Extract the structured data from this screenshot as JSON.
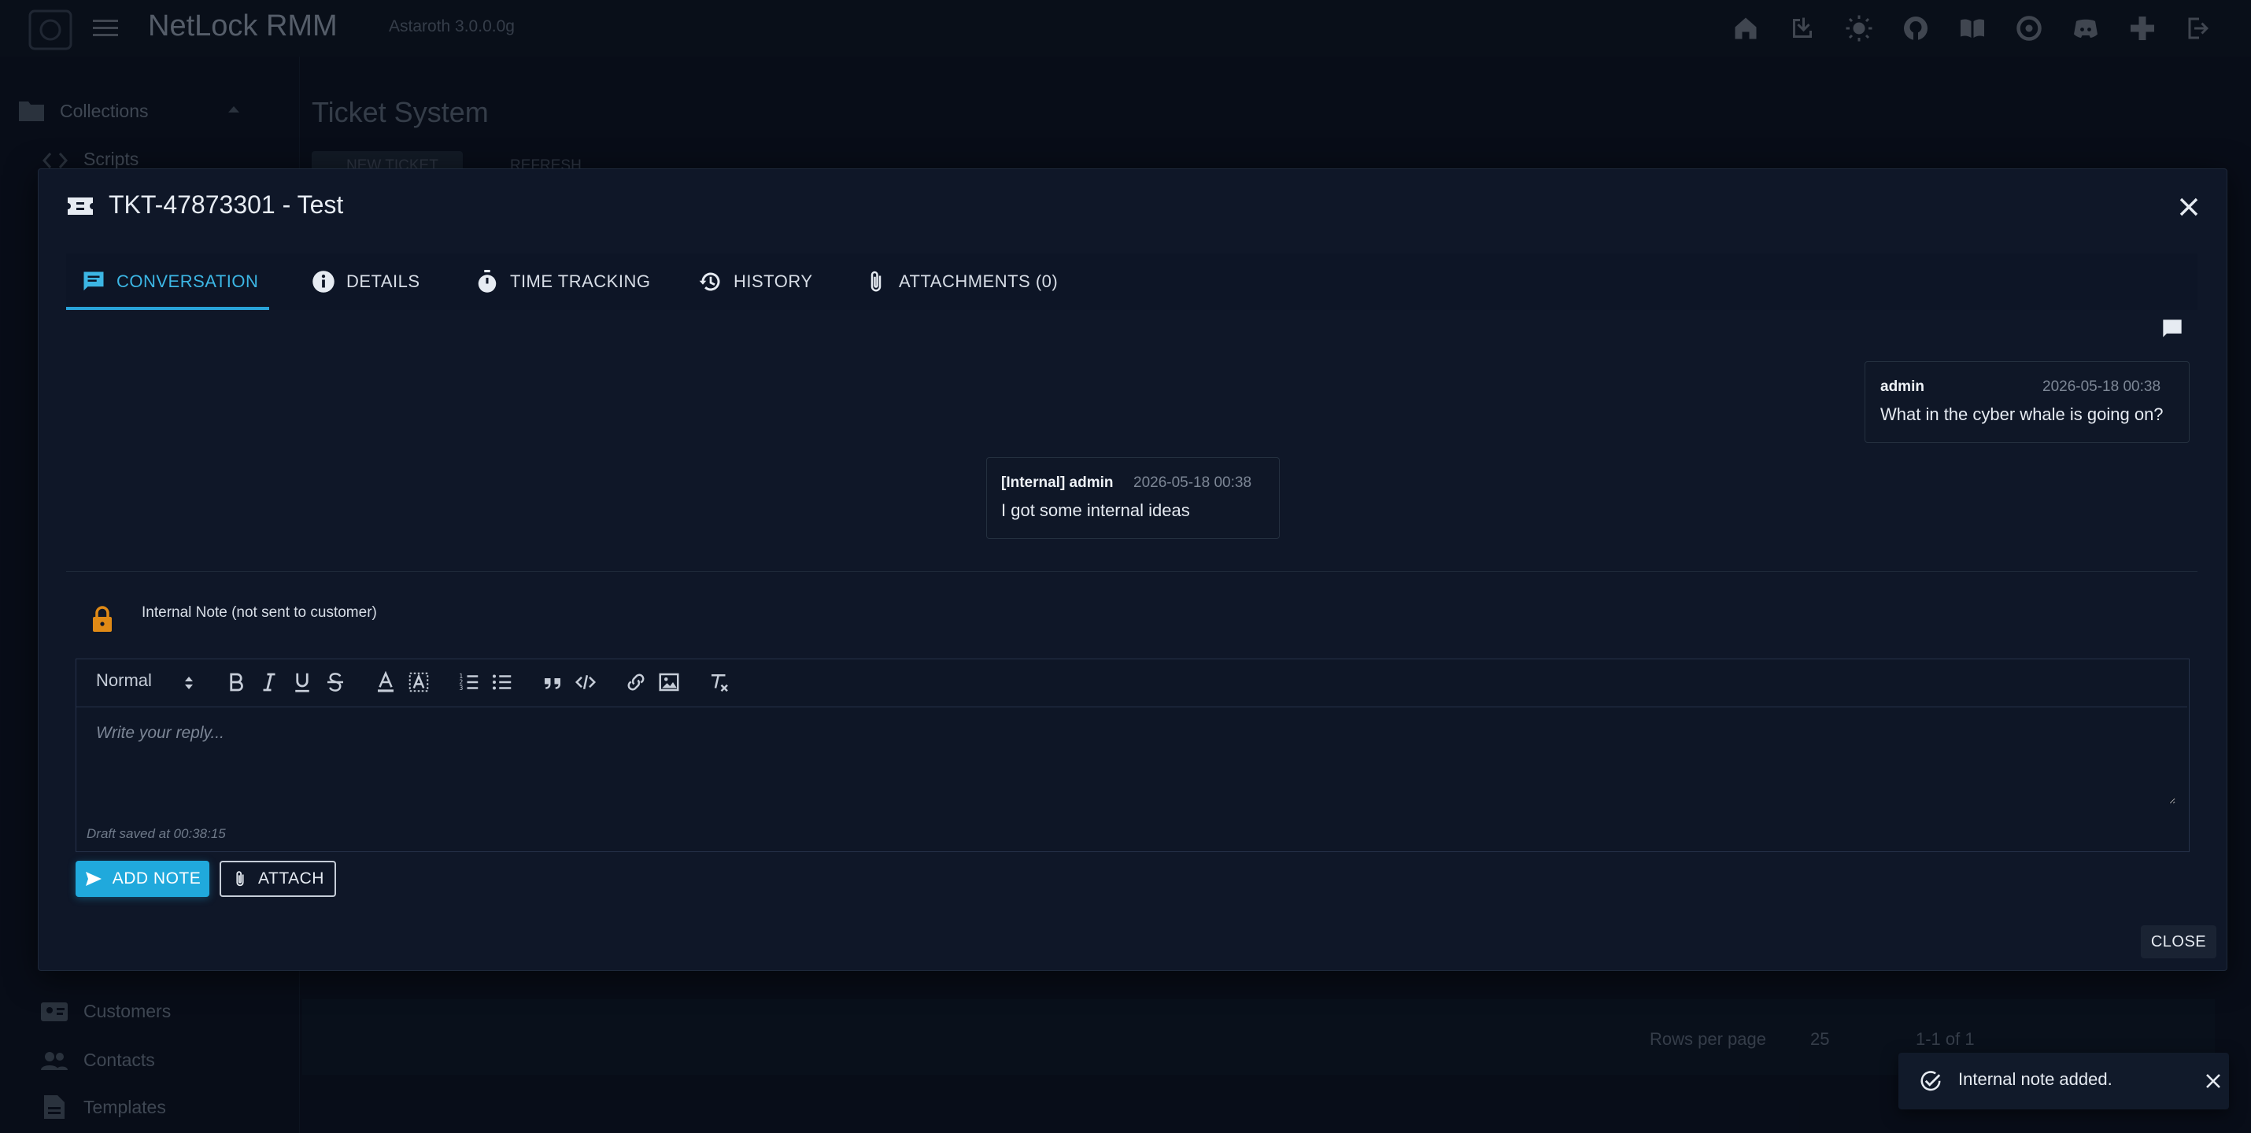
{
  "app": {
    "title": "NetLock RMM",
    "version": "Astaroth 3.0.0.0g"
  },
  "sidebar": {
    "collections_label": "Collections",
    "items": [
      {
        "label": "Scripts",
        "icon": "code-icon"
      },
      {
        "label": "Customers",
        "icon": "customers-icon"
      },
      {
        "label": "Contacts",
        "icon": "contacts-icon"
      },
      {
        "label": "Templates",
        "icon": "document-icon"
      }
    ]
  },
  "background": {
    "page_title": "Ticket System",
    "new_ticket_label": "NEW TICKET",
    "refresh_label": "REFRESH",
    "rows_per_page_label": "Rows per page",
    "rows_per_page_value": "25",
    "pagination_text": "1-1 of 1"
  },
  "dialog": {
    "title": "TKT-47873301 - Test",
    "tabs": [
      {
        "label": "CONVERSATION",
        "icon": "chat-icon",
        "active": true
      },
      {
        "label": "DETAILS",
        "icon": "info-icon",
        "active": false
      },
      {
        "label": "TIME TRACKING",
        "icon": "stopwatch-icon",
        "active": false
      },
      {
        "label": "HISTORY",
        "icon": "history-icon",
        "active": false
      },
      {
        "label": "ATTACHMENTS (0)",
        "icon": "paperclip-icon",
        "active": false
      }
    ],
    "messages": [
      {
        "author": "admin",
        "time": "2026-05-18 00:38",
        "text": "What in the cyber whale is going on?"
      },
      {
        "author": "[Internal] admin",
        "time": "2026-05-18 00:38",
        "text": "I got some internal ideas"
      }
    ],
    "internal_note_label": "Internal Note (not sent to customer)",
    "editor": {
      "format_value": "Normal",
      "placeholder": "Write your reply...",
      "draft_status": "Draft saved at 00:38:15"
    },
    "add_note_label": "ADD NOTE",
    "attach_label": "ATTACH",
    "close_label": "CLOSE"
  },
  "toast": {
    "message": "Internal note added."
  },
  "colors": {
    "accent": "#20a9dc",
    "lock": "#e08a16",
    "background": "#0b1220",
    "dialog": "#0f1728"
  }
}
